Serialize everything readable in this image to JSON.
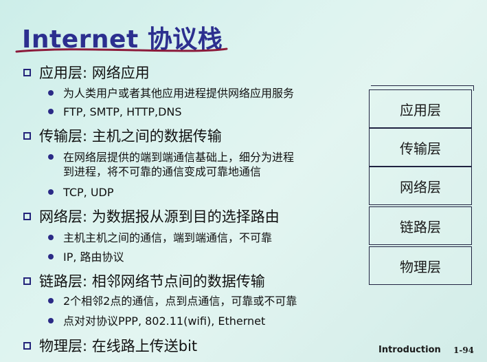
{
  "title": "Internet 协议栈",
  "sections": [
    {
      "heading": "应用层: 网络应用",
      "bullets": [
        "为人类用户或者其他应用进程提供网络应用服务",
        "FTP, SMTP, HTTP,DNS"
      ]
    },
    {
      "heading": "传输层: 主机之间的数据传输",
      "bullets": [
        "在网络层提供的端到端通信基础上，细分为进程|到进程，将不可靠的通信变成可靠地通信",
        "TCP, UDP"
      ]
    },
    {
      "heading": "网络层: 为数据报从源到目的选择路由",
      "bullets": [
        "主机主机之间的通信，端到端通信，不可靠",
        "IP, 路由协议"
      ]
    },
    {
      "heading": "链路层: 相邻网络节点间的数据传输",
      "bullets": [
        "2个相邻2点的通信，点到点通信，可靠或不可靠",
        "点对对协议PPP, 802.11(wifi), Ethernet"
      ]
    },
    {
      "heading": "物理层: 在线路上传送bit",
      "bullets": []
    }
  ],
  "stack": [
    "应用层",
    "传输层",
    "网络层",
    "链路层",
    "物理层"
  ],
  "footer": {
    "label": "Introduction",
    "page": "1-94"
  },
  "colors": {
    "title": "#2c2f8f",
    "underline": "#8b1a3a",
    "bullet": "#2a2a86"
  }
}
